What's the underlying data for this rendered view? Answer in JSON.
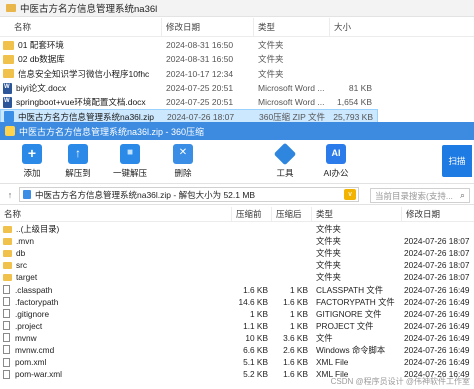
{
  "explorer": {
    "title": "中医古方名方信息管理系统na36l",
    "headers": {
      "name": "名称",
      "modified": "修改日期",
      "type": "类型",
      "size": "大小"
    },
    "rows": [
      {
        "name": "01 配套环境",
        "date": "2024-08-31 16:50",
        "type": "文件夹",
        "size": "",
        "icon": "folder",
        "selected": false
      },
      {
        "name": "02 db数据库",
        "date": "2024-08-31 16:50",
        "type": "文件夹",
        "size": "",
        "icon": "folder",
        "selected": false
      },
      {
        "name": "信息安全知识学习微信小程序10fhc",
        "date": "2024-10-17 12:34",
        "type": "文件夹",
        "size": "",
        "icon": "folder",
        "selected": false
      },
      {
        "name": "biyi论文.docx",
        "date": "2024-07-25 20:51",
        "type": "Microsoft Word ...",
        "size": "81 KB",
        "icon": "doc",
        "selected": false
      },
      {
        "name": "springboot+vue环境配置文档.docx",
        "date": "2024-07-25 20:51",
        "type": "Microsoft Word ...",
        "size": "1,654 KB",
        "icon": "doc",
        "selected": false
      },
      {
        "name": "中医古方名方信息管理系统na36l.zip",
        "date": "2024-07-26 18:07",
        "type": "360压缩 ZIP 文件",
        "size": "25,793 KB",
        "icon": "zip",
        "selected": true
      }
    ]
  },
  "zip_window": {
    "title": "中医古方名方信息管理系统na36l.zip - 360压缩",
    "toolbar": {
      "add": "添加",
      "extract": "解压到",
      "one_click": "一键解压",
      "delete": "删除",
      "tools": "工具",
      "ai": "AI办公",
      "scan": "扫描"
    },
    "path": "中医古方名方信息管理系统na36l.zip - 解包大小为 52.1 MB",
    "search_placeholder": "当前目录搜索(支持...",
    "headers": {
      "name": "名称",
      "before": "压缩前",
      "after": "压缩后",
      "type": "类型",
      "modified": "修改日期"
    },
    "rows": [
      {
        "name": "..(上级目录)",
        "before": "",
        "after": "",
        "type": "文件夹",
        "date": "",
        "icon": "folder"
      },
      {
        "name": ".mvn",
        "before": "",
        "after": "",
        "type": "文件夹",
        "date": "2024-07-26 18:07",
        "icon": "folder"
      },
      {
        "name": "db",
        "before": "",
        "after": "",
        "type": "文件夹",
        "date": "2024-07-26 18:07",
        "icon": "folder"
      },
      {
        "name": "src",
        "before": "",
        "after": "",
        "type": "文件夹",
        "date": "2024-07-26 18:07",
        "icon": "folder"
      },
      {
        "name": "target",
        "before": "",
        "after": "",
        "type": "文件夹",
        "date": "2024-07-26 18:07",
        "icon": "folder"
      },
      {
        "name": ".classpath",
        "before": "1.6 KB",
        "after": "1 KB",
        "type": "CLASSPATH 文件",
        "date": "2024-07-26 16:49",
        "icon": "file"
      },
      {
        "name": ".factorypath",
        "before": "14.6 KB",
        "after": "1.6 KB",
        "type": "FACTORYPATH 文件",
        "date": "2024-07-26 16:49",
        "icon": "file"
      },
      {
        "name": ".gitignore",
        "before": "1 KB",
        "after": "1 KB",
        "type": "GITIGNORE 文件",
        "date": "2024-07-26 16:49",
        "icon": "file"
      },
      {
        "name": ".project",
        "before": "1.1 KB",
        "after": "1 KB",
        "type": "PROJECT 文件",
        "date": "2024-07-26 16:49",
        "icon": "file"
      },
      {
        "name": "mvnw",
        "before": "10 KB",
        "after": "3.6 KB",
        "type": "文件",
        "date": "2024-07-26 16:49",
        "icon": "file"
      },
      {
        "name": "mvnw.cmd",
        "before": "6.6 KB",
        "after": "2.6 KB",
        "type": "Windows 命令脚本",
        "date": "2024-07-26 16:49",
        "icon": "file"
      },
      {
        "name": "pom.xml",
        "before": "5.1 KB",
        "after": "1.6 KB",
        "type": "XML File",
        "date": "2024-07-26 16:49",
        "icon": "file"
      },
      {
        "name": "pom-war.xml",
        "before": "5.2 KB",
        "after": "1.6 KB",
        "type": "XML File",
        "date": "2024-07-26 16:49",
        "icon": "file"
      }
    ]
  },
  "watermark": "CSDN @程序员设计 @伟神软件工作室"
}
